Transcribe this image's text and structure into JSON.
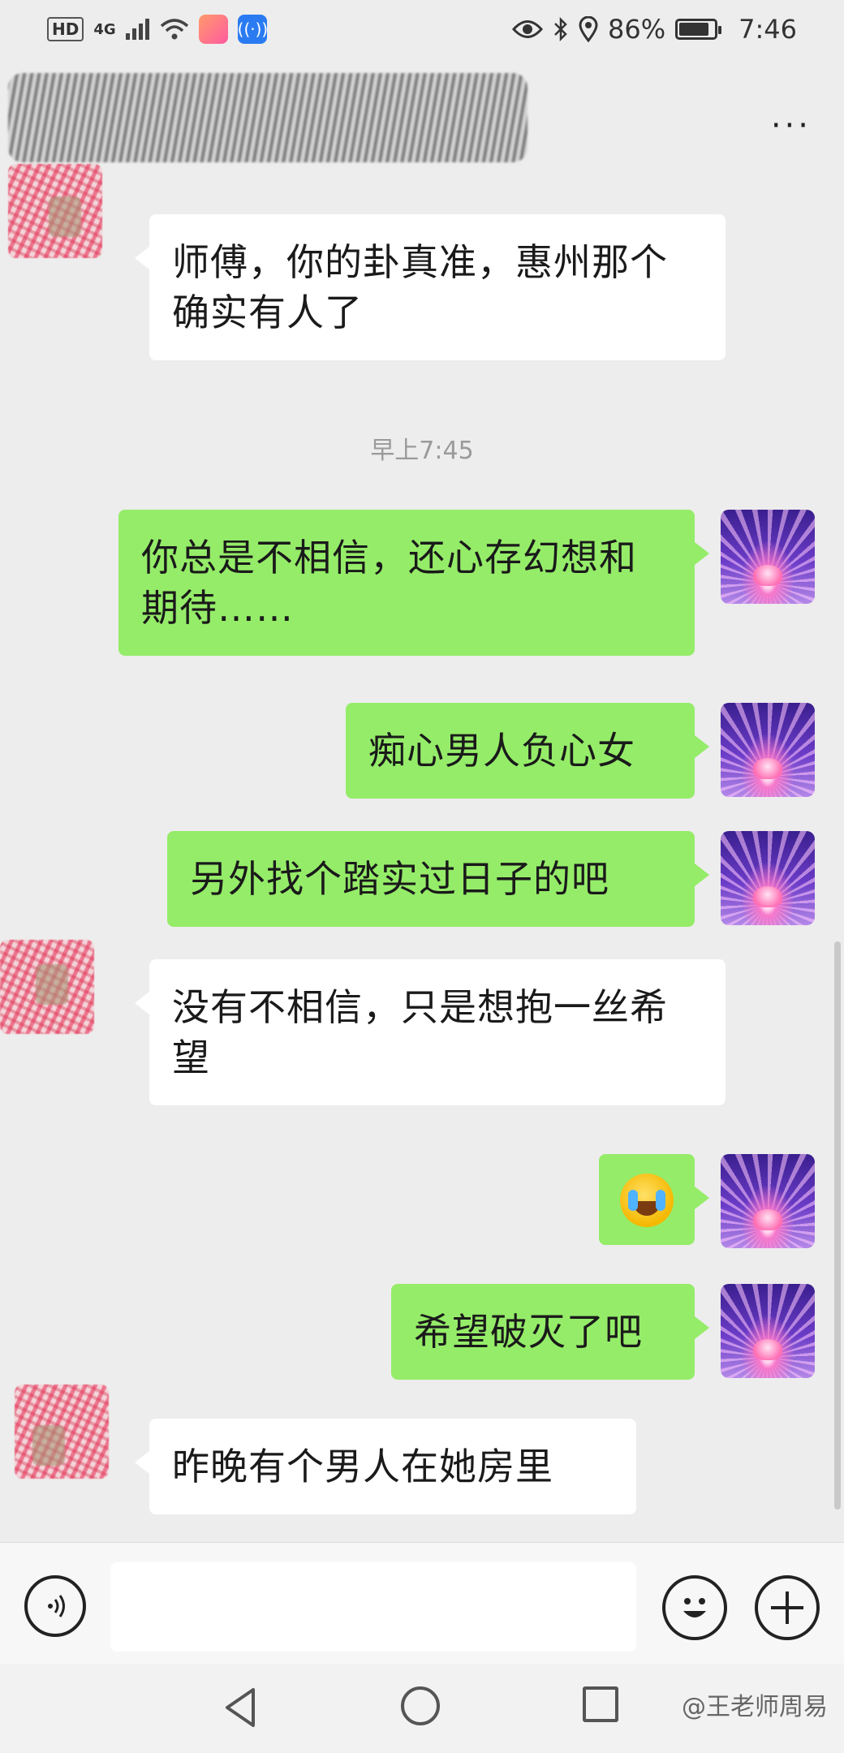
{
  "status_bar": {
    "hd": "HD",
    "network": "4G",
    "battery": "86%",
    "battery_level": 0.86,
    "time": "7:46"
  },
  "header": {
    "more_label": "···"
  },
  "messages": [
    {
      "side": "in",
      "text": "师傅，你的卦真准，惠州那个确实有人了"
    },
    {
      "timestamp": "早上7:45"
    },
    {
      "side": "out",
      "text": "你总是不相信，还心存幻想和期待……"
    },
    {
      "side": "out",
      "text": "痴心男人负心女"
    },
    {
      "side": "out",
      "text": "另外找个踏实过日子的吧"
    },
    {
      "side": "in",
      "text": "没有不相信，只是想抱一丝希望"
    },
    {
      "side": "out",
      "emoji": "crying-laughing-emoji"
    },
    {
      "side": "out",
      "text": "希望破灭了吧"
    },
    {
      "side": "in",
      "text": "昨晚有个男人在她房里"
    }
  ],
  "input_bar": {
    "voice_icon": "voice-icon",
    "emoji_icon": "emoji-icon",
    "plus_icon": "plus-icon"
  },
  "watermark": "@王老师周易"
}
